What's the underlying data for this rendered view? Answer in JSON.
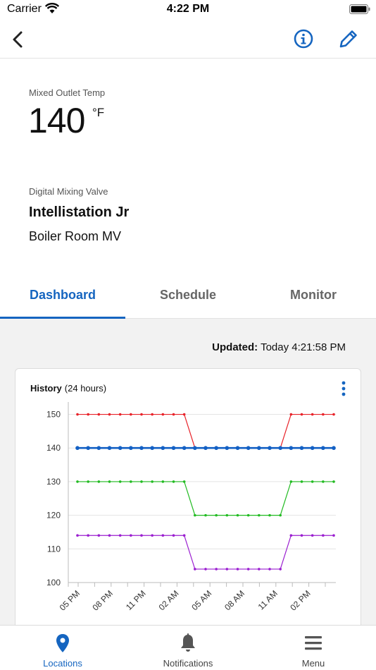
{
  "status_bar": {
    "carrier": "Carrier",
    "time": "4:22 PM"
  },
  "nav": {
    "back_icon": "chevron-left-icon",
    "info_icon": "info-circle-icon",
    "edit_icon": "pencil-icon"
  },
  "reading": {
    "label": "Mixed Outlet Temp",
    "value": "140",
    "unit": "°F"
  },
  "device": {
    "type": "Digital Mixing Valve",
    "name": "Intellistation Jr",
    "location": "Boiler Room MV"
  },
  "tabs": [
    {
      "label": "Dashboard",
      "active": true
    },
    {
      "label": "Schedule",
      "active": false
    },
    {
      "label": "Monitor",
      "active": false
    }
  ],
  "updated": {
    "label": "Updated:",
    "value": "Today 4:21:58 PM"
  },
  "history": {
    "title": "History",
    "range": "(24 hours)"
  },
  "colors": {
    "accent": "#1565c0",
    "red": "#e8232a",
    "green": "#22bb22",
    "purple": "#9b1fd0",
    "blue": "#1360c4"
  },
  "chart_data": {
    "type": "line",
    "x": [
      "05 PM",
      "",
      "08 PM",
      "",
      "11 PM",
      "",
      "02 AM",
      "",
      "05 AM",
      "",
      "08 AM",
      "",
      "11 AM",
      "",
      "02 PM",
      ""
    ],
    "xtick_labels": [
      "05 PM",
      "08 PM",
      "11 PM",
      "02 AM",
      "05 AM",
      "08 AM",
      "11 AM",
      "02 PM"
    ],
    "yticks": [
      100,
      110,
      120,
      130,
      140,
      150
    ],
    "ylim": [
      100,
      152
    ],
    "grid": true,
    "series": [
      {
        "color": "#e8232a",
        "values": [
          150,
          150,
          150,
          150,
          150,
          150,
          150,
          150,
          150,
          150,
          150,
          140,
          140,
          140,
          140,
          140,
          140,
          140,
          140,
          140,
          150,
          150,
          150,
          150,
          150
        ]
      },
      {
        "color": "#1360c4",
        "values": [
          140,
          140,
          140,
          140,
          140,
          140,
          140,
          140,
          140,
          140,
          140,
          140,
          140,
          140,
          140,
          140,
          140,
          140,
          140,
          140,
          140,
          140,
          140,
          140,
          140
        ]
      },
      {
        "color": "#22bb22",
        "values": [
          130,
          130,
          130,
          130,
          130,
          130,
          130,
          130,
          130,
          130,
          130,
          120,
          120,
          120,
          120,
          120,
          120,
          120,
          120,
          120,
          130,
          130,
          130,
          130,
          130
        ]
      },
      {
        "color": "#9b1fd0",
        "values": [
          114,
          114,
          114,
          114,
          114,
          114,
          114,
          114,
          114,
          114,
          114,
          104,
          104,
          104,
          104,
          104,
          104,
          104,
          104,
          104,
          114,
          114,
          114,
          114,
          114
        ]
      }
    ]
  },
  "bottom_nav": [
    {
      "label": "Locations",
      "icon": "map-pin-icon",
      "active": true
    },
    {
      "label": "Notifications",
      "icon": "bell-icon",
      "active": false
    },
    {
      "label": "Menu",
      "icon": "hamburger-menu-icon",
      "active": false
    }
  ]
}
